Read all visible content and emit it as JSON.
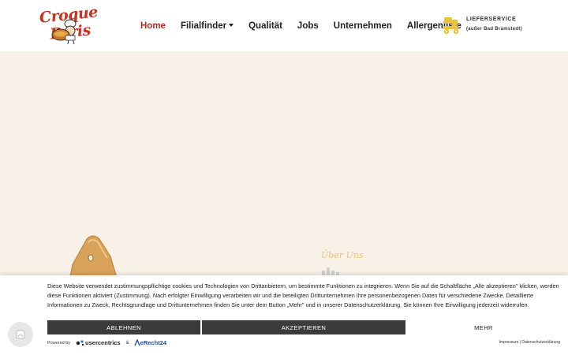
{
  "header": {
    "logo_text": "Croque Paris",
    "nav": [
      {
        "label": "Home",
        "active": true
      },
      {
        "label": "Filialfinder",
        "dropdown": true
      },
      {
        "label": "Qualität"
      },
      {
        "label": "Jobs"
      },
      {
        "label": "Unternehmen"
      },
      {
        "label": "Allergenliste"
      }
    ],
    "delivery": {
      "title": "LIEFERSERVICE",
      "subtitle": "(außer Bad Bramstedt)",
      "icon": "delivery-scooter-icon"
    }
  },
  "hero": {
    "about_label": "Über Uns",
    "background_color": "#f7f1e7",
    "accent_color": "#e9c275"
  },
  "cookie_banner": {
    "text": "Diese Website verwendet zustimmungspflichtige cookies und Technologien von Drittanbietern, um bestimmte Funktionen zu integrieren. Wenn Sie auf die Schaltfläche „Alle akzeptieren\" klicken, werden diese Funktionen aktiviert (Zustimmung). Nach erfolgter Einwilligung verarbeiten wir und die beteiligten Drittunternehmen Ihre personenbezogenen Daten für verschiedene Zwecke. Detaillierte Informationen zu Zweck, Rechtsgrundlage und Drittunternehmen finden Sie unter dem Button „Mehr\" und in unserer Datenschutzerklärung. Sie können Ihre Einwilligung jederzeit widerrufen.",
    "deny_label": "ABLEHNEN",
    "accept_label": "AKZEPTIEREN",
    "more_label": "MEHR",
    "powered_by": "Powered by",
    "usercentrics": "usercentrics",
    "amp": "&",
    "erecht": "eRecht24",
    "impressum": "Impressum",
    "separator": "|",
    "datenschutz": "Datenschutzerklärung",
    "button_color": "#3b3b3b"
  },
  "colors": {
    "brand_red": "#b22a1d",
    "logo_red": "#c8321e",
    "delivery_yellow": "#f0c23c"
  }
}
